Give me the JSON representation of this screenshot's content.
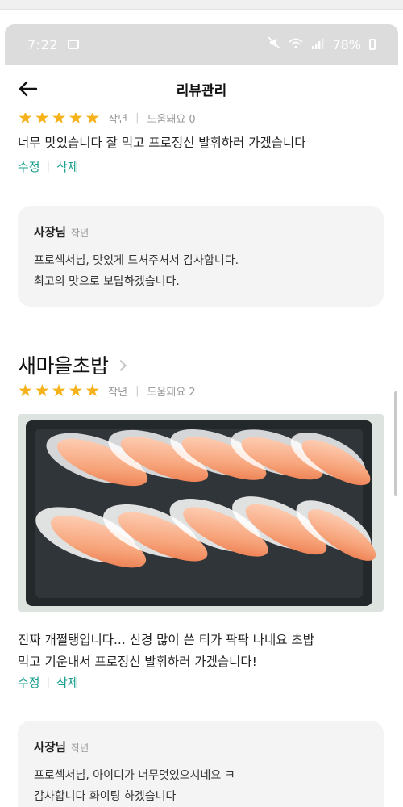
{
  "status_bar": {
    "time": "7:22",
    "battery": "78%"
  },
  "app_bar": {
    "title": "리뷰관리"
  },
  "review1": {
    "rating": 5,
    "time": "작년",
    "helpful": "도움돼요 0",
    "text": "너무 맛있습니다 잘 먹고 프로정신 발휘하러 가겠습니다",
    "edit_label": "수정",
    "delete_label": "삭제",
    "owner_reply": {
      "name": "사장님",
      "time": "작년",
      "lines": [
        "프로섹서님, 맛있게 드셔주셔서 감사합니다.",
        "최고의 맛으로 보답하겠습니다."
      ]
    }
  },
  "review2": {
    "store_name": "새마을초밥",
    "rating": 5,
    "time": "작년",
    "helpful": "도움돼요 2",
    "text_lines": [
      "진짜 개쩔탱입니다... 신경 많이 쓴 티가 팍팍 나네요 초밥",
      "먹고 기운내서 프로정신 발휘하러 가겠습니다!"
    ],
    "edit_label": "수정",
    "delete_label": "삭제",
    "owner_reply": {
      "name": "사장님",
      "time": "작년",
      "lines": [
        "프로섹서님, 아이디가 너무멋있으시네요 ㅋ",
        "감사합니다 화이팅 하겠습니다"
      ]
    }
  },
  "colors": {
    "star": "#f5b21a",
    "action": "#1a9f8d",
    "card_bg": "#f4f4f4",
    "status_bg": "#dcdcdc"
  },
  "icons": {
    "back": "arrow-left-icon",
    "store_chevron": "chevron-right-icon",
    "status": [
      "image-icon",
      "mute-icon",
      "wifi-icon",
      "signal-icon",
      "battery-icon"
    ]
  }
}
